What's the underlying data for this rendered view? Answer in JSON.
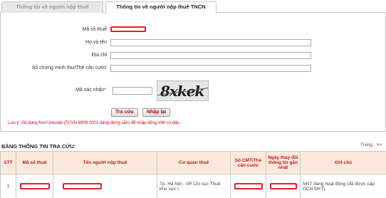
{
  "tabs": {
    "inactive_label": "Thông tin về người nộp thuế",
    "active_label": "Thông tin về người nộp thuế TNCN"
  },
  "form": {
    "tax_code_label": "Mã số thuế",
    "name_label": "Họ và tên",
    "address_label": "Địa chỉ",
    "id_label": "Số chứng minh thư/Thẻ căn cước",
    "captcha_label": "Mã xác nhận",
    "captcha_required": "*",
    "captcha_text": "8xkek",
    "search_button": "Tra cứu",
    "reset_button": "Nhập lại",
    "note": "Lưu ý: Sử dụng font Unicode (TCVN 6909:2001 dạng dựng sẵn) để nhập tiếng Việt có dấu."
  },
  "results": {
    "title": "BẢNG THÔNG TIN TRA CỨU:",
    "paging_label": "Trang:",
    "paging_next": ">>",
    "columns": [
      "STT",
      "Mã số thuế",
      "Tên người nộp thuế",
      "Cơ quan thuế",
      "Số CMT/Thẻ căn cước",
      "Ngày thay đổi thông tin gần nhất",
      "Ghi chú"
    ],
    "rows": [
      {
        "stt": "1",
        "tax_office": "Tp. Hà Nội - VP Chi cục Thuế khu vực I",
        "note": "NNT đang hoạt động (đã được cấp GCN ĐKT)"
      }
    ]
  },
  "colors": {
    "redaction": "#e0202a",
    "header_bg": "#fbe9d9",
    "header_text": "#c0142a",
    "button_text": "#b00000",
    "note_text": "#cc0000"
  }
}
